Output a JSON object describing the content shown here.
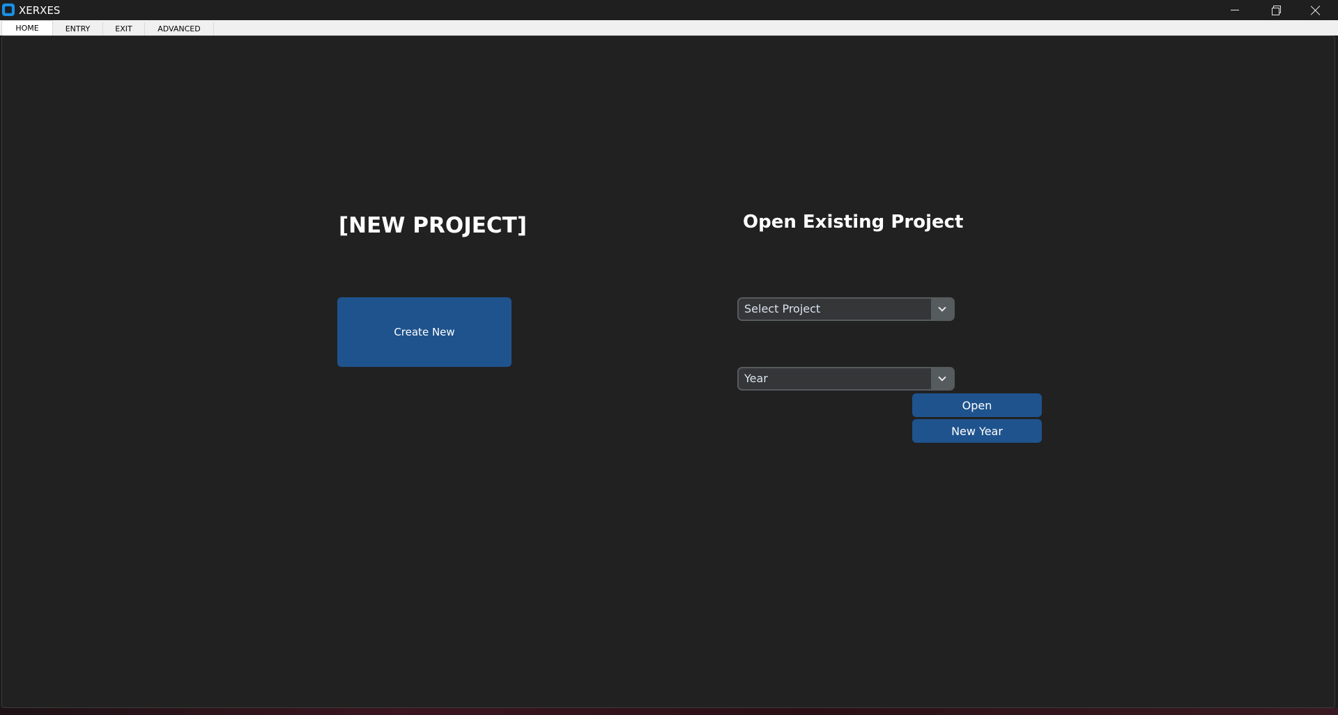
{
  "window": {
    "title": "XERXES",
    "controls": [
      "minimize",
      "maximize",
      "close"
    ]
  },
  "tabs": [
    {
      "label": "HOME",
      "active": true
    },
    {
      "label": "ENTRY",
      "active": false
    },
    {
      "label": "EXIT",
      "active": false
    },
    {
      "label": "ADVANCED",
      "active": false
    }
  ],
  "new_project": {
    "heading": "[NEW PROJECT]",
    "create_button": "Create New"
  },
  "open_project": {
    "heading": "Open Existing Project",
    "project_select": "Select Project",
    "year_select": "Year",
    "open_button": "Open",
    "new_year_button": "New Year"
  },
  "colors": {
    "background": "#212121",
    "button": "#1f538d",
    "combo_bg": "#343638",
    "combo_border": "#565b5e",
    "app_icon": "#1a8fe3"
  }
}
